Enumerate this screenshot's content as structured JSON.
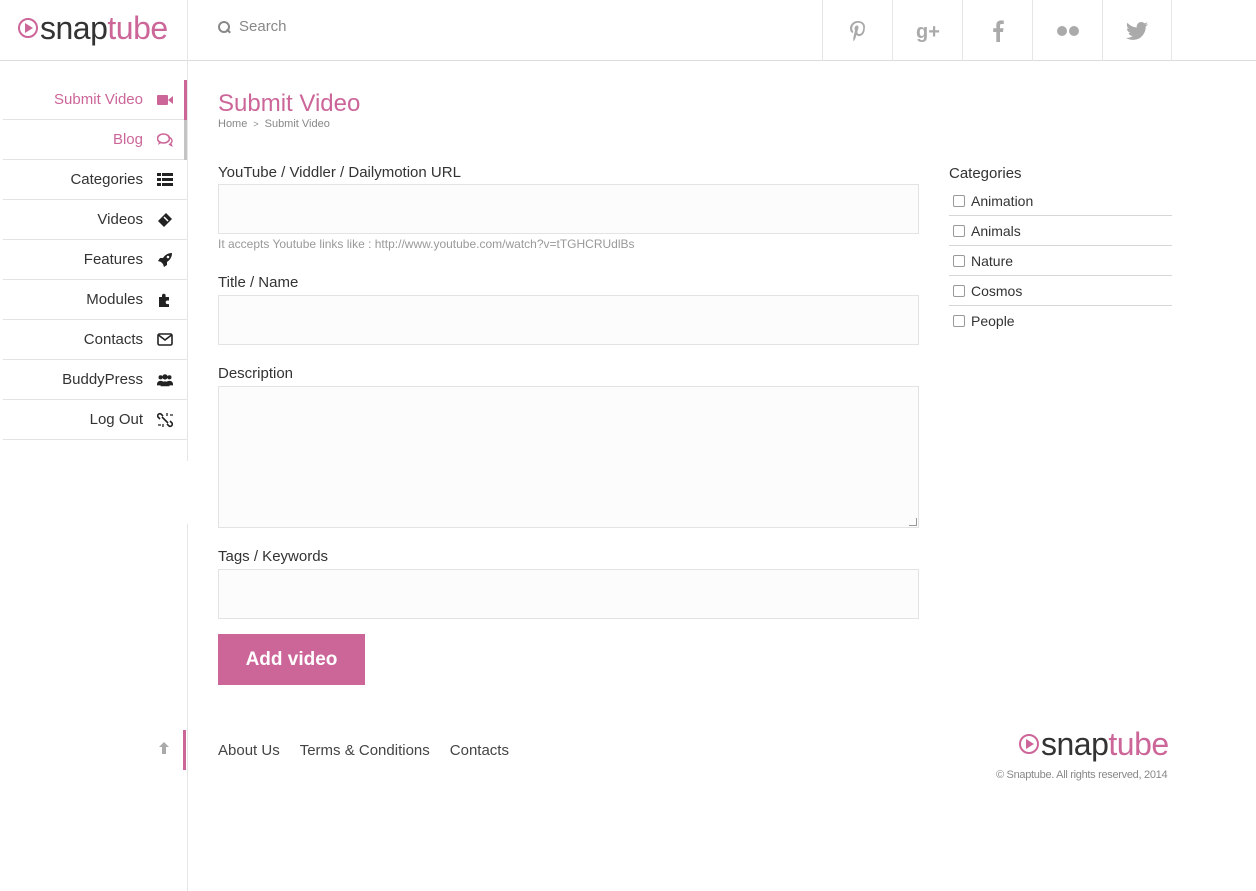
{
  "brand": {
    "snap": "snap",
    "tube": "tube"
  },
  "search": {
    "placeholder": "Search"
  },
  "social": [
    "pinterest-icon",
    "google-plus-icon",
    "facebook-icon",
    "flickr-icon",
    "twitter-icon"
  ],
  "colors": {
    "accent": "#cc6699"
  },
  "sidebar": {
    "items": [
      {
        "label": "Submit Video",
        "icon": "video-camera-icon"
      },
      {
        "label": "Blog",
        "icon": "comments-icon"
      },
      {
        "label": "Categories",
        "icon": "list-icon"
      },
      {
        "label": "Videos",
        "icon": "ticket-icon"
      },
      {
        "label": "Features",
        "icon": "rocket-icon"
      },
      {
        "label": "Modules",
        "icon": "puzzle-icon"
      },
      {
        "label": "Contacts",
        "icon": "envelope-icon"
      },
      {
        "label": "BuddyPress",
        "icon": "users-icon"
      },
      {
        "label": "Log Out",
        "icon": "unlink-icon"
      }
    ]
  },
  "page": {
    "title": "Submit Video",
    "breadcrumb": {
      "home": "Home",
      "separator": ">",
      "current": "Submit Video"
    }
  },
  "form": {
    "url_label": "YouTube / Viddler / Dailymotion URL",
    "url_value": "",
    "url_hint": "It accepts Youtube links like : http://www.youtube.com/watch?v=tTGHCRUdlBs",
    "title_label": "Title / Name",
    "title_value": "",
    "description_label": "Description",
    "description_value": "",
    "tags_label": "Tags / Keywords",
    "tags_value": "",
    "submit_label": "Add video"
  },
  "categories": {
    "title": "Categories",
    "items": [
      "Animation",
      "Animals",
      "Nature",
      "Cosmos",
      "People"
    ]
  },
  "footer": {
    "links": [
      "About Us",
      "Terms & Conditions",
      "Contacts"
    ],
    "copyright": "© Snaptube. All rights reserved, 2014"
  }
}
